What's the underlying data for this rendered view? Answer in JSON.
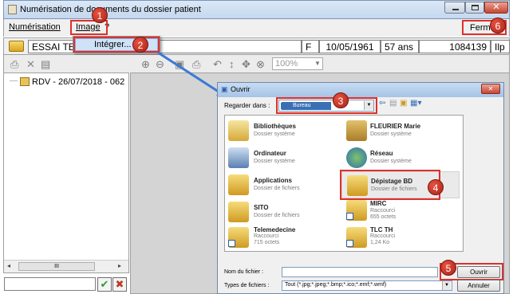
{
  "window": {
    "title": "Numérisation de documents du dossier patient"
  },
  "menu": {
    "items": [
      "Numérisation",
      "Image",
      "?"
    ],
    "close_label": "Fermer",
    "dropdown_item": "Intégrer..."
  },
  "patient": {
    "name": "ESSAI TE",
    "sex": "F",
    "birth_date": "10/05/1961",
    "age": "57 ans",
    "id": "1084139",
    "extra": "Ilp"
  },
  "toolbar": {
    "zoom": "100%"
  },
  "tree": {
    "item": "RDV - 26/07/2018 - 062"
  },
  "scrollbar": {
    "thumb_label": "III"
  },
  "dialog": {
    "title": "Ouvrir",
    "look_in_label": "Regarder dans :",
    "look_in_value": "Bureau",
    "items": [
      {
        "name": "Bibliothèques",
        "sub": "Dossier système",
        "icon": "libraries-icon"
      },
      {
        "name": "FLEURIER Marie",
        "sub": "Dossier système",
        "icon": "user-folder-icon"
      },
      {
        "name": "Ordinateur",
        "sub": "Dossier système",
        "icon": "computer-icon"
      },
      {
        "name": "Réseau",
        "sub": "Dossier système",
        "icon": "network-icon"
      },
      {
        "name": "Applications",
        "sub": "Dossier de fichiers",
        "icon": "folder-icon"
      },
      {
        "name": "Dépistage BD",
        "sub": "Dossier de fichiers",
        "icon": "folder-icon"
      },
      {
        "name": "SITO",
        "sub": "Dossier de fichiers",
        "icon": "folder-icon"
      },
      {
        "name": "MIRC",
        "sub": "Raccourci\n655 octets",
        "icon": "shortcut-icon"
      },
      {
        "name": "Telemedecine",
        "sub": "Raccourci\n715 octets",
        "icon": "shortcut-icon"
      },
      {
        "name": "TLC TH",
        "sub": "Raccourci\n1,24 Ko",
        "icon": "shortcut-icon"
      }
    ],
    "filename_label": "Nom du fichier :",
    "filename_value": "",
    "filetype_label": "Types de fichiers :",
    "filetype_value": "Tout (*.jpg;*.jpeg;*.bmp;*.ico;*.emf;*.wmf)",
    "open_label": "Ouvrir",
    "cancel_label": "Annuler"
  },
  "steps": [
    "1",
    "2",
    "3",
    "4",
    "5",
    "6"
  ],
  "colors": {
    "annotation": "#e0302a",
    "arrow": "#3a7bd5",
    "accept": "#2e9b2e",
    "reject": "#c0392b"
  }
}
